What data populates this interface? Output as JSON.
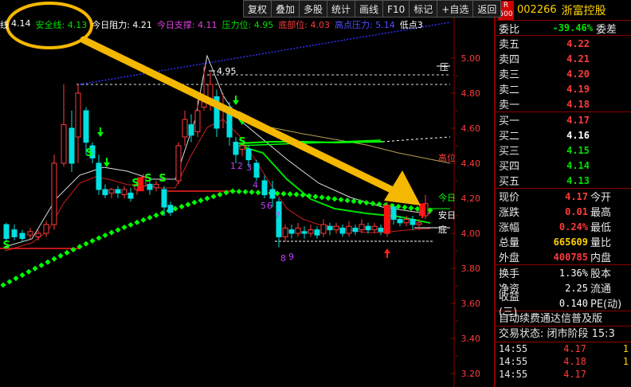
{
  "toolbar": {
    "buttons": [
      "复权",
      "叠加",
      "多股",
      "统计",
      "画线",
      "F10",
      "标记",
      "+自选",
      "返回"
    ]
  },
  "indicators": {
    "line_prefix": "线",
    "line_value": "4.14",
    "safe_label": "安全线: 4.13",
    "today_resist": "今日阻力: 4.21",
    "today_support": "今日支撑: 4.11",
    "pressure": "压力位: 4.95",
    "bottom": "底部位: 4.03",
    "high_pressure": "高点压力: 5.14",
    "low_point": "低点3"
  },
  "chart": {
    "y_labels": [
      "5.00",
      "4.80",
      "4.60",
      "4.40",
      "4.20",
      "4.00",
      "3.80",
      "3.60",
      "3.40",
      "3.20"
    ],
    "peak_label": "4.95",
    "right_tags": [
      "压",
      "高位",
      "今日",
      "安日",
      "底"
    ],
    "count_marks": [
      "1",
      "2",
      "3",
      "4",
      "5",
      "6",
      "7",
      "8",
      "9"
    ],
    "signal_s": "S",
    "colors": {
      "up": "#ff3b3b",
      "down": "#00e0e0",
      "support_dots": "#00ff00",
      "blue_line": "#3030ff",
      "arrow": "#f5b800",
      "circle": "#f5b800"
    }
  },
  "panel": {
    "badge_top": "R",
    "badge_bottom": "500",
    "code": "002266",
    "name": "浙富控股",
    "weibi_label": "委比",
    "weibi_value": "-39.46%",
    "weicha_label": "委差",
    "asks": [
      {
        "label": "卖五",
        "price": "4.22",
        "vol": ""
      },
      {
        "label": "卖四",
        "price": "4.21",
        "vol": ""
      },
      {
        "label": "卖三",
        "price": "4.20",
        "vol": ""
      },
      {
        "label": "卖二",
        "price": "4.19",
        "vol": ""
      },
      {
        "label": "卖一",
        "price": "4.18",
        "vol": ""
      }
    ],
    "bids": [
      {
        "label": "买一",
        "price": "4.17",
        "vol": ""
      },
      {
        "label": "买二",
        "price": "4.16",
        "vol": ""
      },
      {
        "label": "买三",
        "price": "4.15",
        "vol": ""
      },
      {
        "label": "买四",
        "price": "4.14",
        "vol": ""
      },
      {
        "label": "买五",
        "price": "4.13",
        "vol": ""
      }
    ],
    "quote": [
      {
        "l1": "现价",
        "v1": "4.17",
        "c1": "red",
        "l2": "今开"
      },
      {
        "l1": "涨跌",
        "v1": "0.01",
        "c1": "red",
        "l2": "最高"
      },
      {
        "l1": "涨幅",
        "v1": "0.24%",
        "c1": "red",
        "l2": "最低"
      },
      {
        "l1": "总量",
        "v1": "665609",
        "c1": "yellow",
        "l2": "量比"
      },
      {
        "l1": "外盘",
        "v1": "400785",
        "c1": "red",
        "l2": "内盘"
      }
    ],
    "stats": [
      {
        "l1": "换手",
        "v1": "1.36%",
        "l2": "股本"
      },
      {
        "l1": "净资",
        "v1": "2.25",
        "l2": "流通"
      },
      {
        "l1": "收益(三)",
        "v1": "0.140",
        "l2": "PE(动)"
      }
    ],
    "banner": "自动续费通达信普及版",
    "trade_status": "交易状态: 闭市阶段 15:3",
    "ticks": [
      {
        "time": "14:55",
        "price": "4.17",
        "color": "red",
        "num": "1"
      },
      {
        "time": "14:55",
        "price": "4.18",
        "color": "red",
        "num": "1"
      },
      {
        "time": "14:55",
        "price": "4.17",
        "color": "red",
        "num": ""
      }
    ]
  }
}
